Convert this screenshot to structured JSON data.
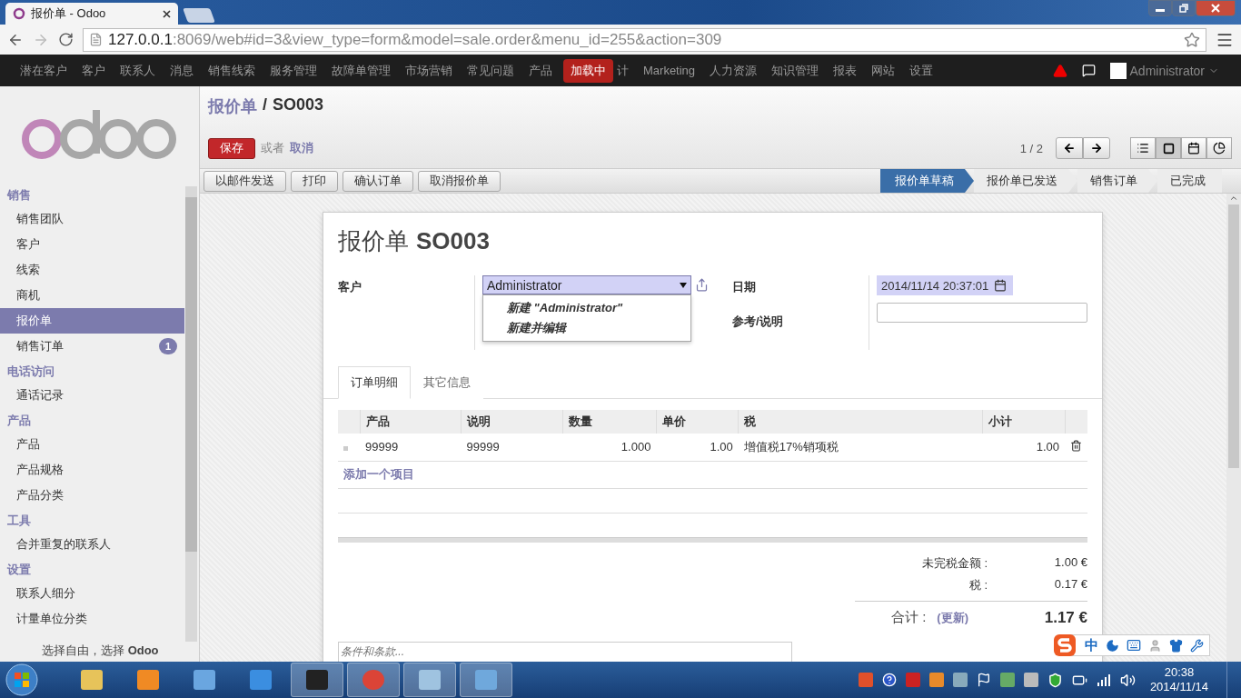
{
  "browser": {
    "tab_title": "报价单 - Odoo",
    "url_host": "127.0.0.1",
    "url_rest": ":8069/web#id=3&view_type=form&model=sale.order&menu_id=255&action=309"
  },
  "top_menu": {
    "items": [
      {
        "label": "潜在客户"
      },
      {
        "label": "客户"
      },
      {
        "label": "联系人"
      },
      {
        "label": "消息"
      },
      {
        "label": "销售线索"
      },
      {
        "label": "服务管理"
      },
      {
        "label": "故障单管理"
      },
      {
        "label": "市场营销"
      },
      {
        "label": "常见问题"
      },
      {
        "label": "产品"
      }
    ],
    "loading_badge": "加载中",
    "items_after": [
      {
        "label": "计"
      },
      {
        "label": "Marketing"
      },
      {
        "label": "人力资源"
      },
      {
        "label": "知识管理"
      },
      {
        "label": "报表"
      },
      {
        "label": "网站"
      },
      {
        "label": "设置"
      }
    ],
    "user": "Administrator"
  },
  "sidebar": {
    "sections": [
      {
        "title": "销售",
        "items": [
          {
            "label": "销售团队",
            "selected": false
          },
          {
            "label": "客户",
            "selected": false
          },
          {
            "label": "线索",
            "selected": false
          },
          {
            "label": "商机",
            "selected": false
          },
          {
            "label": "报价单",
            "selected": true
          },
          {
            "label": "销售订单",
            "selected": false,
            "badge": "1"
          }
        ]
      },
      {
        "title": "电话访问",
        "items": [
          {
            "label": "通话记录",
            "selected": false
          }
        ]
      },
      {
        "title": "产品",
        "items": [
          {
            "label": "产品",
            "selected": false
          },
          {
            "label": "产品规格",
            "selected": false
          },
          {
            "label": "产品分类",
            "selected": false
          }
        ]
      },
      {
        "title": "工具",
        "items": [
          {
            "label": "合并重复的联系人",
            "selected": false
          }
        ]
      },
      {
        "title": "设置",
        "items": [
          {
            "label": "联系人细分",
            "selected": false
          },
          {
            "label": "计量单位分类",
            "selected": false
          }
        ]
      }
    ],
    "footer": "选择自由，选择 **Odoo**"
  },
  "breadcrumb": {
    "parent": "报价单",
    "separator": "/",
    "current": "SO003"
  },
  "actions": {
    "save": "保存",
    "or": "或者",
    "cancel": "取消",
    "pager": "1 / 2"
  },
  "buttons": [
    "以邮件发送",
    "打印",
    "确认订单",
    "取消报价单"
  ],
  "status_steps": [
    {
      "label": "报价单草稿",
      "selected": true
    },
    {
      "label": "报价单已发送",
      "selected": false
    },
    {
      "label": "销售订单",
      "selected": false
    },
    {
      "label": "已完成",
      "selected": false
    }
  ],
  "form": {
    "title_label": "报价单",
    "title_value": "SO003",
    "customer": {
      "label": "客户",
      "value": "Administrator",
      "dropdown": [
        "新建 \"Administrator\"",
        "新建并编辑"
      ]
    },
    "date": {
      "label": "日期",
      "value": "2014/11/14 20:37:01"
    },
    "reference": {
      "label": "参考/说明"
    }
  },
  "tabs": [
    {
      "label": "订单明细",
      "selected": true
    },
    {
      "label": "其它信息",
      "selected": false
    }
  ],
  "table": {
    "columns": [
      "产品",
      "说明",
      "数量",
      "单价",
      "税",
      "小计"
    ],
    "rows": [
      {
        "cells": [
          "99999",
          "99999",
          "1.000",
          "1.00",
          "增值税17%销项税",
          "1.00"
        ]
      }
    ],
    "add_item": "添加一个项目"
  },
  "totals": {
    "lines": [
      {
        "label": "未完税金额 :",
        "value": "1.00 €"
      },
      {
        "label": "税 :",
        "value": "0.17 €"
      }
    ],
    "total_label": "合计 :",
    "update": "(更新)",
    "total_value": "1.17 €"
  },
  "notes": {
    "placeholder": "条件和条款..."
  },
  "ime_bar": {
    "mode": "中"
  },
  "taskbar": {
    "time": "20:38",
    "date": "2014/11/14"
  }
}
